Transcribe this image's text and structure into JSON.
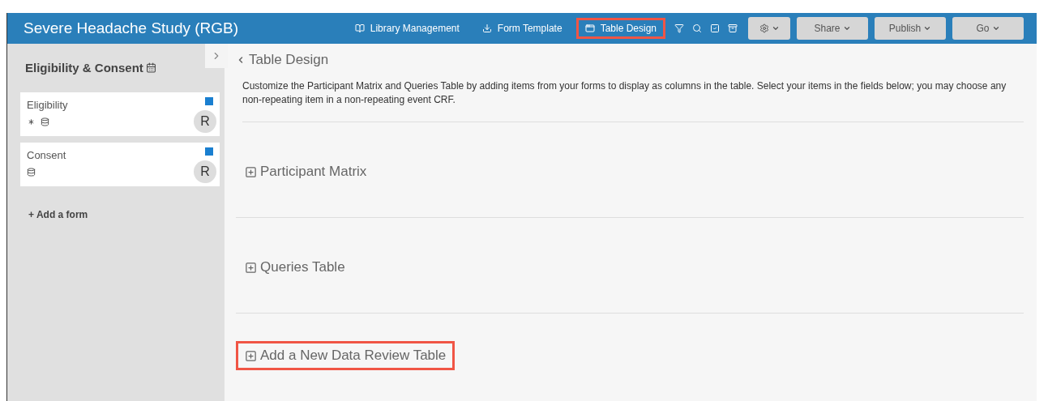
{
  "header": {
    "title": "Severe Headache Study (RGB)",
    "nav": [
      {
        "label": "Library Management",
        "highlighted": false
      },
      {
        "label": "Form Template",
        "highlighted": false
      },
      {
        "label": "Table Design",
        "highlighted": true
      }
    ],
    "buttons": [
      {
        "kind": "gear"
      },
      {
        "label": "Share",
        "kind": "menu"
      },
      {
        "label": "Publish",
        "kind": "menu"
      },
      {
        "label": "Go",
        "kind": "menu"
      }
    ]
  },
  "sidebar": {
    "title": "Eligibility & Consent",
    "forms": [
      {
        "name": "Eligibility",
        "color": "#1a7fd0",
        "required": true,
        "badge": "R"
      },
      {
        "name": "Consent",
        "color": "#1a7fd0",
        "required": false,
        "badge": "R"
      }
    ],
    "add_link": "+ Add a form"
  },
  "main": {
    "back": "Table Design",
    "intro": "Customize the Participant Matrix and Queries Table by adding items from your forms to display as columns in the table. Select your items in the fields below; you may choose any non-repeating item in a non-repeating event CRF.",
    "sections": [
      {
        "label": "Participant Matrix",
        "highlighted": false
      },
      {
        "label": "Queries Table",
        "highlighted": false
      },
      {
        "label": "Add a New Data Review Table",
        "highlighted": true
      }
    ]
  }
}
